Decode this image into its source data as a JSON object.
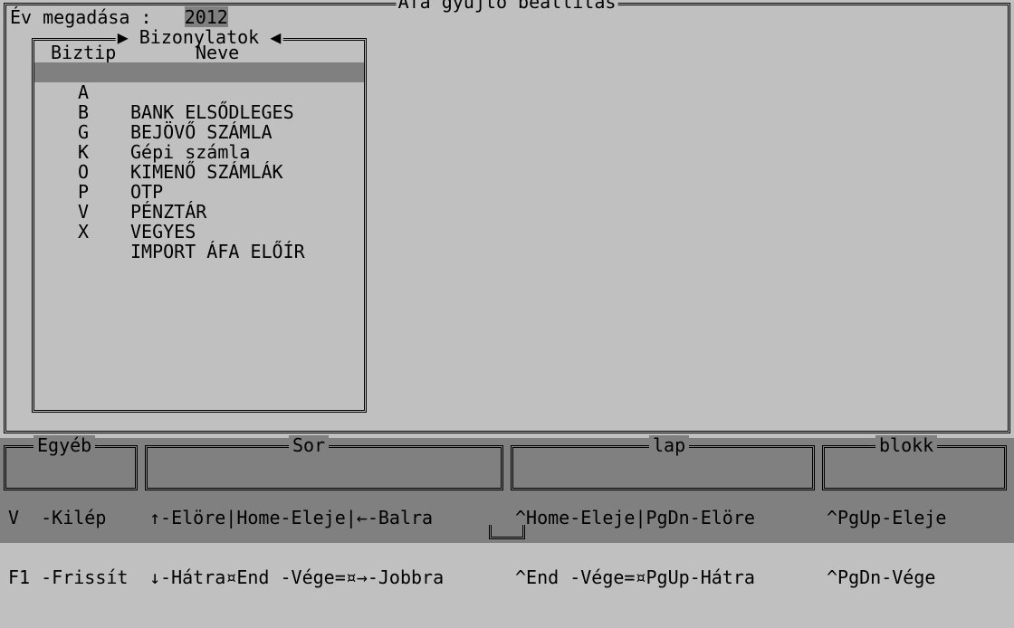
{
  "window_title": "Áfa gyűjtő beállítás",
  "year": {
    "label": "Év megadása :",
    "value": "2012"
  },
  "docs_panel": {
    "title": "▶ Bizonylatok ◀",
    "col_biztip": "Biztip",
    "col_neve": "Neve",
    "selected_index": 0,
    "items": [
      {
        "tip": "A",
        "name": "BANK ELSŐDLEGES"
      },
      {
        "tip": "B",
        "name": "BEJÖVŐ SZÁMLA"
      },
      {
        "tip": "G",
        "name": "Gépi számla"
      },
      {
        "tip": "K",
        "name": "KIMENŐ SZÁMLÁK"
      },
      {
        "tip": "O",
        "name": "OTP"
      },
      {
        "tip": "P",
        "name": "PÉNZTÁR"
      },
      {
        "tip": "V",
        "name": "VEGYES"
      },
      {
        "tip": "X",
        "name": "IMPORT ÁFA ELŐÍR"
      }
    ]
  },
  "footer": {
    "egyeb": {
      "label": "Egyéb",
      "line1": "V  -Kilép",
      "line2": "F1 -Frissít"
    },
    "sor": {
      "label": "Sor",
      "line1": "↑-Elöre|Home-Eleje|←-Balra",
      "line2": "↓-Hátra¤End -Vége=¤→-Jobbra"
    },
    "lap": {
      "label": "lap",
      "line1": "^Home-Eleje|PgDn-Elöre",
      "line2": "^End -Vége=¤PgUp-Hátra"
    },
    "blokk": {
      "label": "blokk",
      "line1": "^PgUp-Eleje",
      "line2": "^PgDn-Vége"
    }
  }
}
